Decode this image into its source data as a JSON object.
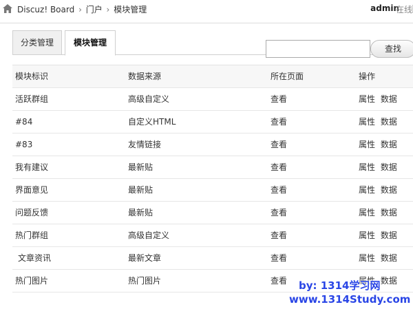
{
  "breadcrumb": {
    "items": [
      "Discuz! Board",
      "门户",
      "模块管理"
    ],
    "separator": "›"
  },
  "user": {
    "name": "admin",
    "status": "在线"
  },
  "tabs": [
    {
      "label": "分类管理",
      "active": false
    },
    {
      "label": "模块管理",
      "active": true
    }
  ],
  "search": {
    "value": "",
    "button_label": "查找"
  },
  "table": {
    "headers": [
      "模块标识",
      "数据来源",
      "所在页面",
      "操作"
    ],
    "rows": [
      {
        "id": "活跃群组",
        "source": "高级自定义",
        "page": "查看",
        "op1": "属性",
        "op2": "数据"
      },
      {
        "id": "#84",
        "source": "自定义HTML",
        "page": "查看",
        "op1": "属性",
        "op2": "数据"
      },
      {
        "id": "#83",
        "source": "友情链接",
        "page": "查看",
        "op1": "属性",
        "op2": "数据"
      },
      {
        "id": "我有建议",
        "source": "最新贴",
        "page": "查看",
        "op1": "属性",
        "op2": "数据"
      },
      {
        "id": "界面意见",
        "source": "最新贴",
        "page": "查看",
        "op1": "属性",
        "op2": "数据"
      },
      {
        "id": "问题反馈",
        "source": "最新贴",
        "page": "查看",
        "op1": "属性",
        "op2": "数据"
      },
      {
        "id": "热门群组",
        "source": "高级自定义",
        "page": "查看",
        "op1": "属性",
        "op2": "数据"
      },
      {
        "id": "文章资讯",
        "source": "最新文章",
        "page": "查看",
        "op1": "属性",
        "op2": "数据"
      },
      {
        "id": "热门图片",
        "source": "热门图片",
        "page": "查看",
        "op1": "属性",
        "op2": "数据"
      }
    ]
  },
  "watermark": {
    "line1": "by: 1314学习网",
    "line2": "www.1314Study.com"
  },
  "colors": {
    "watermark": "#2a46e6",
    "header_bg": "#f7f7f7",
    "tab_inactive_bg": "#f0f0f0"
  }
}
